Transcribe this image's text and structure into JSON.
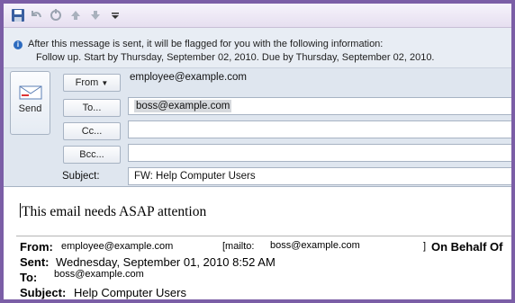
{
  "toolbar": {
    "icons": [
      "save-icon",
      "undo-icon",
      "redo-icon",
      "up-arrow-icon",
      "down-arrow-icon",
      "customize-dropdown-icon"
    ]
  },
  "infobar": {
    "line1": "After this message is sent, it will be flagged for you with the following information:",
    "line2": "Follow up.  Start by Thursday, September 02, 2010.  Due by Thursday, September 02, 2010."
  },
  "compose": {
    "send_label": "Send",
    "from_label": "From",
    "from_value": "employee@example.com",
    "to_label": "To...",
    "to_value": "boss@example.com",
    "cc_label": "Cc...",
    "cc_value": "",
    "bcc_label": "Bcc...",
    "bcc_value": "",
    "subject_label": "Subject:",
    "subject_value": "FW: Help Computer Users"
  },
  "body": {
    "first_line": "This email needs ASAP attention",
    "from_label": "From:",
    "from_value": "employee@example.com",
    "mailto_label": "[mailto:",
    "mailto_value": "boss@example.com",
    "mailto_close": "]",
    "on_behalf": "On Behalf Of",
    "sent_label": "Sent:",
    "sent_value": "Wednesday, September 01, 2010 8:52 AM",
    "to_label": "To:",
    "to_value": "boss@example.com",
    "subject_label": "Subject:",
    "subject_value": "Help Computer Users"
  }
}
